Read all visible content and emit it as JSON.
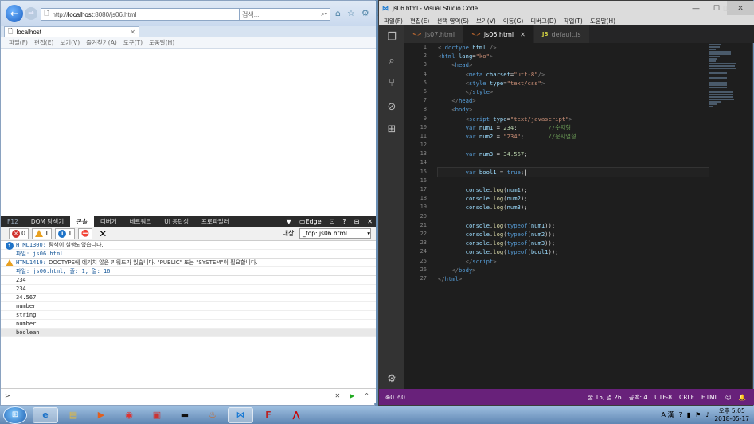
{
  "ie": {
    "address": {
      "prefix": "http://",
      "host": "localhost",
      "rest": ":8080/js06.html"
    },
    "search_placeholder": "검색...",
    "tab_title": "localhost",
    "menu": [
      "파일(F)",
      "편집(E)",
      "보기(V)",
      "즐겨찾기(A)",
      "도구(T)",
      "도움말(H)"
    ]
  },
  "devtools": {
    "tabs": [
      "F12",
      "DOM 탐색기",
      "콘솔",
      "디버거",
      "네트워크",
      "UI 응답성",
      "프로파일러"
    ],
    "active_tab": "콘솔",
    "edge_label": "Edge",
    "counts": {
      "errors": "0",
      "warnings": "1",
      "info": "1"
    },
    "target_label": "대상:",
    "target_value": "_top: js06.html",
    "messages": [
      {
        "code": "HTML1300:",
        "text": "탐색이 실행되었습니다.",
        "sub": "파일: js06.html"
      },
      {
        "code": "HTML1419:",
        "text": "DOCTYPE에 예기치 않은 키워드가 있습니다. \"PUBLIC\" 또는 \"SYSTEM\"이 필요합니다.",
        "sub": "파일: js06.html, 줄: 1, 열: 16"
      }
    ],
    "logs": [
      "234",
      "234",
      "34.567",
      "number",
      "string",
      "number",
      "boolean"
    ],
    "prompt": ">"
  },
  "vscode": {
    "title": "js06.html - Visual Studio Code",
    "menu": [
      "파일(F)",
      "편집(E)",
      "선택 영역(S)",
      "보기(V)",
      "이동(G)",
      "디버그(D)",
      "작업(T)",
      "도움말(H)"
    ],
    "tabs": [
      {
        "label": "js07.html",
        "kind": "html"
      },
      {
        "label": "js06.html",
        "kind": "html",
        "active": true
      },
      {
        "label": "default.js",
        "kind": "js"
      }
    ],
    "tab_icon_html": "<>",
    "tab_icon_js": "JS",
    "lines": [
      [
        [
          "br",
          "<!"
        ],
        [
          "tg",
          "doctype"
        ],
        [
          "at",
          " html "
        ],
        [
          "br",
          "/>"
        ]
      ],
      [
        [
          "br",
          "<"
        ],
        [
          "tg",
          "html"
        ],
        [
          "at",
          " lang"
        ],
        [
          "",
          "="
        ],
        [
          "st",
          "\"ko\""
        ],
        [
          "br",
          ">"
        ]
      ],
      [
        [
          "",
          "    "
        ],
        [
          "br",
          "<"
        ],
        [
          "tg",
          "head"
        ],
        [
          "br",
          ">"
        ]
      ],
      [
        [
          "",
          "        "
        ],
        [
          "br",
          "<"
        ],
        [
          "tg",
          "meta"
        ],
        [
          "at",
          " charset"
        ],
        [
          "",
          "="
        ],
        [
          "st",
          "\"utf-8\""
        ],
        [
          "br",
          "/>"
        ]
      ],
      [
        [
          "",
          "        "
        ],
        [
          "br",
          "<"
        ],
        [
          "tg",
          "style"
        ],
        [
          "at",
          " type"
        ],
        [
          "",
          "="
        ],
        [
          "st",
          "\"text/css\""
        ],
        [
          "br",
          ">"
        ]
      ],
      [
        [
          "",
          "        "
        ],
        [
          "br",
          "</"
        ],
        [
          "tg",
          "style"
        ],
        [
          "br",
          ">"
        ]
      ],
      [
        [
          "",
          "    "
        ],
        [
          "br",
          "</"
        ],
        [
          "tg",
          "head"
        ],
        [
          "br",
          ">"
        ]
      ],
      [
        [
          "",
          "    "
        ],
        [
          "br",
          "<"
        ],
        [
          "tg",
          "body"
        ],
        [
          "br",
          ">"
        ]
      ],
      [
        [
          "",
          "        "
        ],
        [
          "br",
          "<"
        ],
        [
          "tg",
          "script"
        ],
        [
          "at",
          " type"
        ],
        [
          "",
          "="
        ],
        [
          "st",
          "\"text/javascript\""
        ],
        [
          "br",
          ">"
        ]
      ],
      [
        [
          "",
          "        "
        ],
        [
          "kw",
          "var"
        ],
        [
          "at",
          " num1"
        ],
        [
          "",
          " = "
        ],
        [
          "nm",
          "234"
        ],
        [
          "",
          ";         "
        ],
        [
          "cm",
          "//숫자형"
        ]
      ],
      [
        [
          "",
          "        "
        ],
        [
          "kw",
          "var"
        ],
        [
          "at",
          " num2"
        ],
        [
          "",
          " = "
        ],
        [
          "st",
          "\"234\""
        ],
        [
          "",
          ";       "
        ],
        [
          "cm",
          "//문자열형"
        ]
      ],
      [],
      [
        [
          "",
          "        "
        ],
        [
          "kw",
          "var"
        ],
        [
          "at",
          " num3"
        ],
        [
          "",
          " = "
        ],
        [
          "nm",
          "34.567"
        ],
        [
          "",
          ";"
        ]
      ],
      [],
      [
        [
          "",
          "        "
        ],
        [
          "kw",
          "var"
        ],
        [
          "at",
          " bool1"
        ],
        [
          "",
          " = "
        ],
        [
          "kw",
          "true"
        ],
        [
          "",
          ";"
        ]
      ],
      [],
      [
        [
          "",
          "        "
        ],
        [
          "at",
          "console"
        ],
        [
          "",
          "."
        ],
        [
          "fn",
          "log"
        ],
        [
          "",
          "("
        ],
        [
          "at",
          "num1"
        ],
        [
          "",
          ");"
        ]
      ],
      [
        [
          "",
          "        "
        ],
        [
          "at",
          "console"
        ],
        [
          "",
          "."
        ],
        [
          "fn",
          "log"
        ],
        [
          "",
          "("
        ],
        [
          "at",
          "num2"
        ],
        [
          "",
          ");"
        ]
      ],
      [
        [
          "",
          "        "
        ],
        [
          "at",
          "console"
        ],
        [
          "",
          "."
        ],
        [
          "fn",
          "log"
        ],
        [
          "",
          "("
        ],
        [
          "at",
          "num3"
        ],
        [
          "",
          ");"
        ]
      ],
      [],
      [
        [
          "",
          "        "
        ],
        [
          "at",
          "console"
        ],
        [
          "",
          "."
        ],
        [
          "fn",
          "log"
        ],
        [
          "",
          "("
        ],
        [
          "kw",
          "typeof"
        ],
        [
          "",
          "("
        ],
        [
          "at",
          "num1"
        ],
        [
          "",
          "));"
        ]
      ],
      [
        [
          "",
          "        "
        ],
        [
          "at",
          "console"
        ],
        [
          "",
          "."
        ],
        [
          "fn",
          "log"
        ],
        [
          "",
          "("
        ],
        [
          "kw",
          "typeof"
        ],
        [
          "",
          "("
        ],
        [
          "at",
          "num2"
        ],
        [
          "",
          "));"
        ]
      ],
      [
        [
          "",
          "        "
        ],
        [
          "at",
          "console"
        ],
        [
          "",
          "."
        ],
        [
          "fn",
          "log"
        ],
        [
          "",
          "("
        ],
        [
          "kw",
          "typeof"
        ],
        [
          "",
          "("
        ],
        [
          "at",
          "num3"
        ],
        [
          "",
          "));"
        ]
      ],
      [
        [
          "",
          "        "
        ],
        [
          "at",
          "console"
        ],
        [
          "",
          "."
        ],
        [
          "fn",
          "log"
        ],
        [
          "",
          "("
        ],
        [
          "kw",
          "typeof"
        ],
        [
          "",
          "("
        ],
        [
          "at",
          "bool1"
        ],
        [
          "",
          "));"
        ]
      ],
      [
        [
          "",
          "        "
        ],
        [
          "br",
          "</"
        ],
        [
          "tg",
          "script"
        ],
        [
          "br",
          ">"
        ]
      ],
      [
        [
          "",
          "    "
        ],
        [
          "br",
          "</"
        ],
        [
          "tg",
          "body"
        ],
        [
          "br",
          ">"
        ]
      ],
      [
        [
          "br",
          "</"
        ],
        [
          "tg",
          "html"
        ],
        [
          "br",
          ">"
        ]
      ]
    ],
    "current_line": 15,
    "status": {
      "problems": "⊗0 ⚠0",
      "position": "줄 15, 열 26",
      "spaces": "공백: 4",
      "encoding": "UTF-8",
      "eol": "CRLF",
      "language": "HTML",
      "smiley": "☺",
      "bell": "🔔"
    }
  },
  "taskbar": {
    "clock_time": "오후 5:05",
    "clock_date": "2018-05-17",
    "lang": "A 漢"
  }
}
